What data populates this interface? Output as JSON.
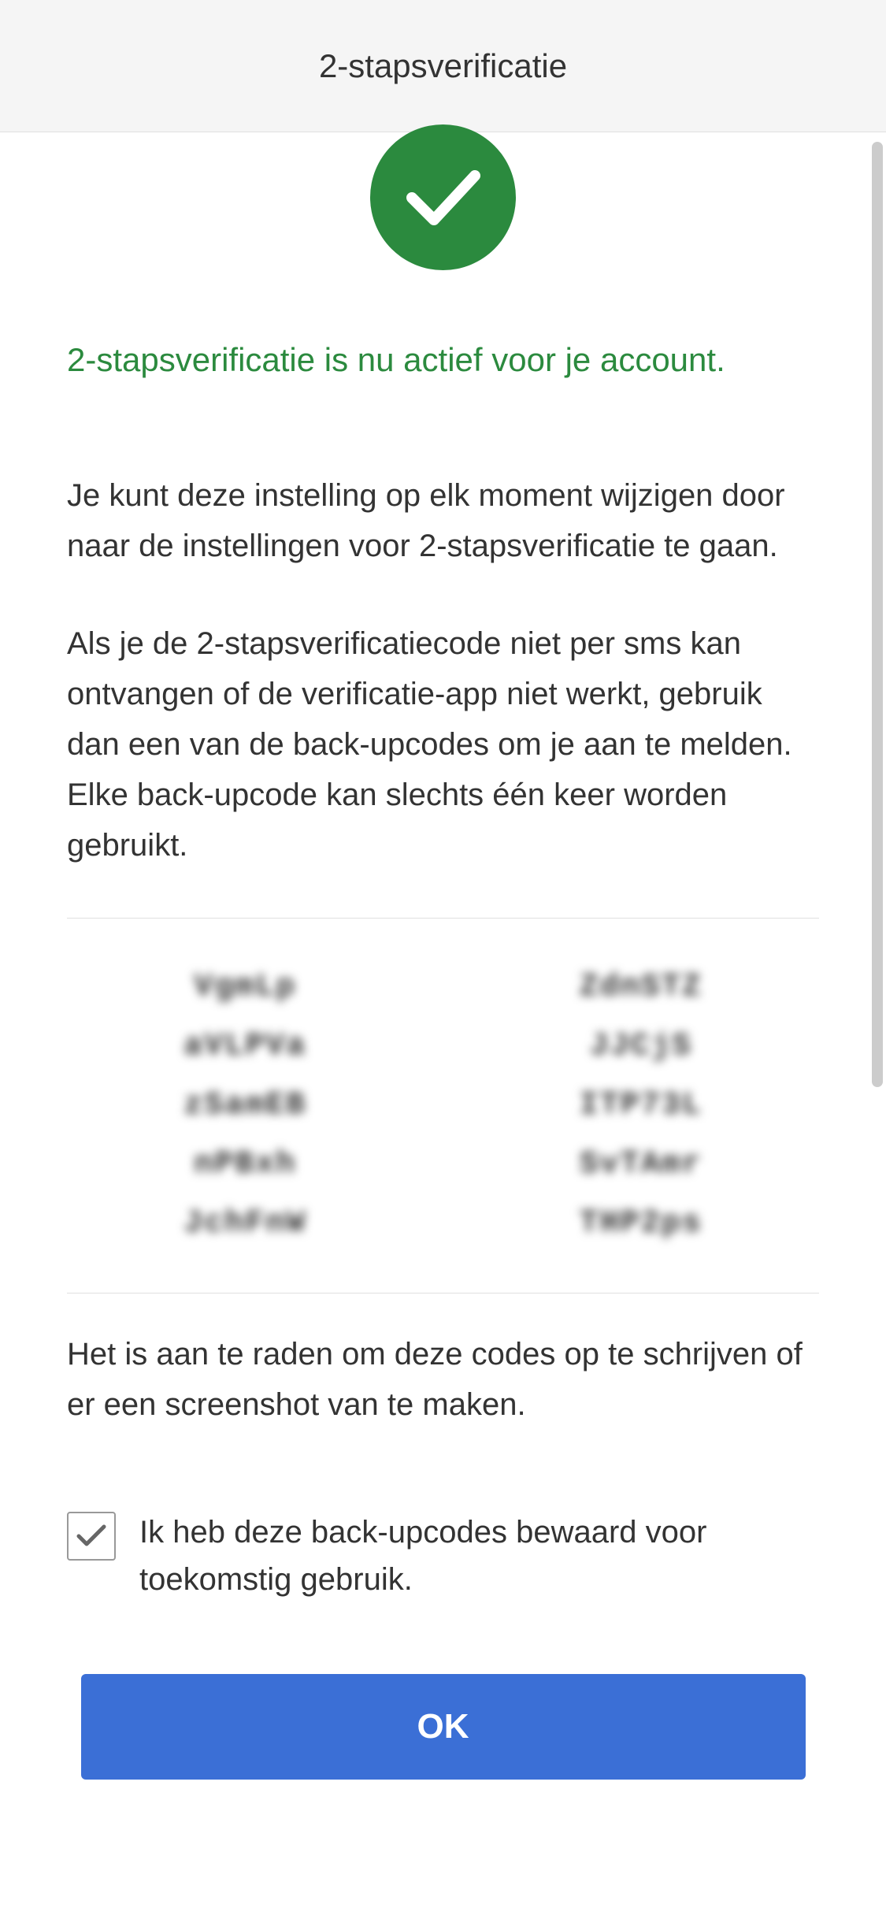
{
  "header": {
    "title": "2-stapsverificatie"
  },
  "success": {
    "message": "2-stapsverificatie is nu actief voor je account.",
    "icon_name": "checkmark"
  },
  "descriptions": {
    "paragraph1": "Je kunt deze instelling op elk moment wijzigen door naar de instellingen voor 2-stapsverificatie te gaan.",
    "paragraph2": "Als je de 2-stapsverificatiecode niet per sms kan ontvangen of de verificatie-app niet werkt, gebruik dan een van de back-upcodes om je aan te melden. Elke back-upcode kan slechts één keer worden gebruikt."
  },
  "backup_codes": [
    "VgmLp",
    "ZdnSTZ",
    "aVLPVa",
    "JJCjS",
    "zSamEB",
    "ITP73L",
    "nPBxh",
    "SvTAmr",
    "JchFnW",
    "THP2ps"
  ],
  "recommendation": "Het is aan te raden om deze codes op te schrijven of er een screenshot van te maken.",
  "checkbox": {
    "label": "Ik heb deze back-upcodes bewaard voor toekomstig gebruik.",
    "checked": true
  },
  "button": {
    "ok_label": "OK"
  },
  "colors": {
    "success_green": "#2b8a3e",
    "primary_blue": "#3b6fd6",
    "text": "#333333",
    "header_bg": "#f5f5f5"
  }
}
